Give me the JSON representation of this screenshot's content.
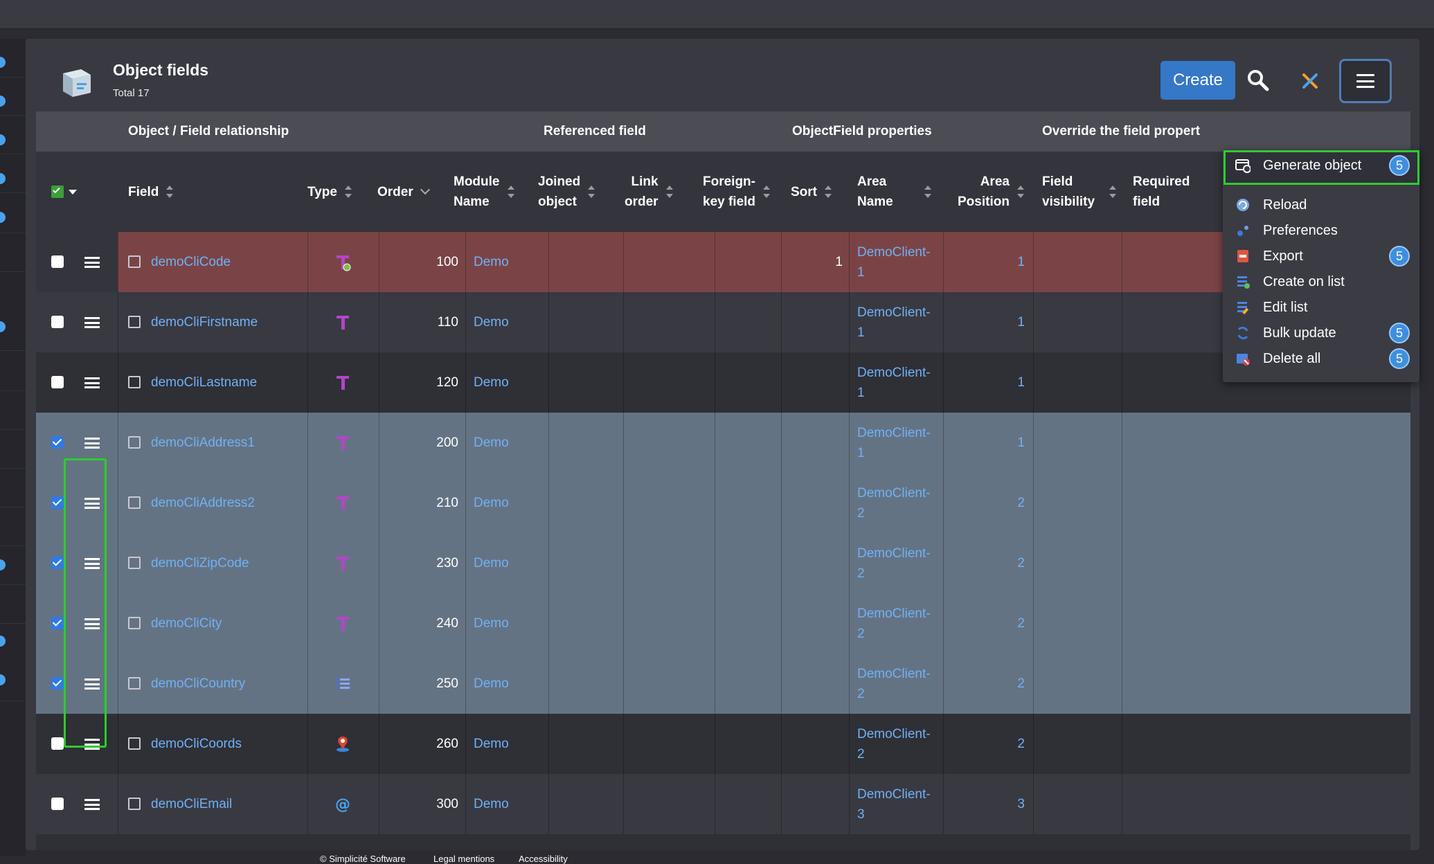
{
  "page": {
    "title": "Object fields",
    "total": "Total 17"
  },
  "toolbar": {
    "create_label": "Create"
  },
  "groups": [
    "Object / Field relationship",
    "Referenced field",
    "ObjectField properties",
    "Override the field propert"
  ],
  "columns": {
    "field": "Field",
    "type": "Type",
    "order": "Order",
    "module": [
      "Module",
      "Name"
    ],
    "joined": [
      "Joined",
      "object"
    ],
    "link": [
      "Link",
      "order"
    ],
    "fk": [
      "Foreign-",
      "key field"
    ],
    "sort": "Sort",
    "area": [
      "Area",
      "Name"
    ],
    "areapos": [
      "Area",
      "Position"
    ],
    "fieldvis": [
      "Field",
      "visibility"
    ],
    "required": [
      "Required",
      "field"
    ]
  },
  "rows": [
    {
      "checked": false,
      "name": "demoCliCode",
      "type": "key",
      "order": "100",
      "module": "Demo",
      "sort": "1",
      "area": [
        "DemoClient-",
        "1"
      ],
      "pos": "1",
      "style": "err"
    },
    {
      "checked": false,
      "name": "demoCliFirstname",
      "type": "text",
      "order": "110",
      "module": "Demo",
      "sort": "",
      "area": [
        "DemoClient-",
        "1"
      ],
      "pos": "1",
      "style": "mid"
    },
    {
      "checked": false,
      "name": "demoCliLastname",
      "type": "text",
      "order": "120",
      "module": "Demo",
      "sort": "",
      "area": [
        "DemoClient-",
        "1"
      ],
      "pos": "1",
      "style": "dark"
    },
    {
      "checked": true,
      "name": "demoCliAddress1",
      "type": "text",
      "order": "200",
      "module": "Demo",
      "sort": "",
      "area": [
        "DemoClient-",
        "1"
      ],
      "pos": "1",
      "style": "selrow"
    },
    {
      "checked": true,
      "name": "demoCliAddress2",
      "type": "text",
      "order": "210",
      "module": "Demo",
      "sort": "",
      "area": [
        "DemoClient-",
        "2"
      ],
      "pos": "2",
      "style": "selrow"
    },
    {
      "checked": true,
      "name": "demoCliZipCode",
      "type": "text",
      "order": "230",
      "module": "Demo",
      "sort": "",
      "area": [
        "DemoClient-",
        "2"
      ],
      "pos": "2",
      "style": "selrow"
    },
    {
      "checked": true,
      "name": "demoCliCity",
      "type": "text",
      "order": "240",
      "module": "Demo",
      "sort": "",
      "area": [
        "DemoClient-",
        "2"
      ],
      "pos": "2",
      "style": "selrow"
    },
    {
      "checked": true,
      "name": "demoCliCountry",
      "type": "list",
      "order": "250",
      "module": "Demo",
      "sort": "",
      "area": [
        "DemoClient-",
        "2"
      ],
      "pos": "2",
      "style": "selrow"
    },
    {
      "checked": false,
      "name": "demoCliCoords",
      "type": "geo",
      "order": "260",
      "module": "Demo",
      "sort": "",
      "area": [
        "DemoClient-",
        "2"
      ],
      "pos": "2",
      "style": "dark"
    },
    {
      "checked": false,
      "name": "demoCliEmail",
      "type": "email",
      "order": "300",
      "module": "Demo",
      "sort": "",
      "area": [
        "DemoClient-",
        "3"
      ],
      "pos": "3",
      "style": "mid"
    }
  ],
  "menu": [
    {
      "label": "Generate object",
      "badge": "5",
      "icon": "generate-object-icon"
    },
    {
      "label": "Reload",
      "badge": "",
      "icon": "reload-icon"
    },
    {
      "label": "Preferences",
      "badge": "",
      "icon": "preferences-icon"
    },
    {
      "label": "Export",
      "badge": "5",
      "icon": "export-icon"
    },
    {
      "label": "Create on list",
      "badge": "",
      "icon": "create-on-list-icon"
    },
    {
      "label": "Edit list",
      "badge": "",
      "icon": "edit-list-icon"
    },
    {
      "label": "Bulk update",
      "badge": "5",
      "icon": "bulk-update-icon"
    },
    {
      "label": "Delete all",
      "badge": "5",
      "icon": "delete-all-icon"
    }
  ],
  "footer": {
    "copyright": "© Simplicité Software",
    "legal": "Legal mentions",
    "accessibility": "Accessibility"
  },
  "colors": {
    "accent": "#3478c7",
    "highlight": "#2ecc2e",
    "link": "#6fb1f5",
    "error_row": "#7a4446",
    "selected_row": "#647384"
  }
}
